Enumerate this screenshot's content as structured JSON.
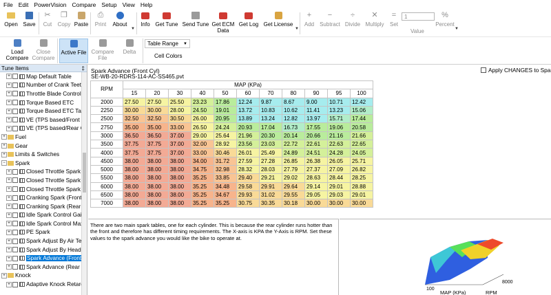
{
  "menu": [
    "File",
    "Edit",
    "PowerVision",
    "Compare",
    "Setup",
    "View",
    "Help"
  ],
  "toolbar1": {
    "open": "Open",
    "save": "Save",
    "cut": "Cut",
    "copy": "Copy",
    "paste": "Paste",
    "print": "Print",
    "about": "About",
    "info": "Info",
    "get_tune": "Get Tune",
    "send_tune": "Send Tune",
    "get_ecm_line1": "Get ECM",
    "get_ecm_line2": "Data",
    "get_log": "Get Log",
    "get_license": "Get License",
    "add": "Add",
    "subtract": "Subtract",
    "divide": "Divide",
    "multiply": "Multiply",
    "set": "Set",
    "value_field": "1",
    "value_label": "Value",
    "percent": "Percent"
  },
  "toolbar2": {
    "load_compare_line1": "Load",
    "load_compare_line2": "Compare",
    "close_compare_line1": "Close",
    "close_compare_line2": "Compare",
    "active_file": "Active File",
    "compare_file": "Compare File",
    "delta": "Delta",
    "table_range": "Table Range",
    "cell_colors": "Cell Colors"
  },
  "left_panel": {
    "header": "Tune Items",
    "pin": "‡",
    "items": [
      {
        "label": "Map Default Table",
        "kind": "table",
        "level": 1
      },
      {
        "label": "Number of Crank Teeth",
        "kind": "table",
        "level": 1
      },
      {
        "label": "Throttle Blade Control",
        "kind": "table",
        "level": 1
      },
      {
        "label": "Torque Based ETC",
        "kind": "table",
        "level": 1
      },
      {
        "label": "Torque Based ETC Table",
        "kind": "table",
        "level": 1
      },
      {
        "label": "VE (TPS based/Front Cyl)",
        "kind": "table",
        "level": 1
      },
      {
        "label": "VE (TPS based/Rear Cyl)",
        "kind": "table",
        "level": 1
      },
      {
        "label": "Fuel",
        "kind": "folder",
        "level": 0
      },
      {
        "label": "Gear",
        "kind": "folder",
        "level": 0
      },
      {
        "label": "Limits & Switches",
        "kind": "folder",
        "level": 0
      },
      {
        "label": "Spark",
        "kind": "folder",
        "level": 0
      },
      {
        "label": "Closed Throttle Spark (Front Cyl)",
        "kind": "table",
        "level": 1
      },
      {
        "label": "Closed Throttle Spark (Rear Cyl)",
        "kind": "table",
        "level": 1
      },
      {
        "label": "Closed Throttle Spark Multiplier",
        "kind": "table",
        "level": 1
      },
      {
        "label": "Cranking Spark (Front Cyl)",
        "kind": "table",
        "level": 1
      },
      {
        "label": "Cranking Spark (Rear Cyl)",
        "kind": "table",
        "level": 1
      },
      {
        "label": "Idle Spark Control Gain",
        "kind": "table",
        "level": 1
      },
      {
        "label": "Idle Spark Control Max",
        "kind": "table",
        "level": 1
      },
      {
        "label": "PE Spark",
        "kind": "table",
        "level": 1
      },
      {
        "label": "Spark Adjust By Air Temp",
        "kind": "table",
        "level": 1
      },
      {
        "label": "Spark Adjust By Head Temp",
        "kind": "table",
        "level": 1
      },
      {
        "label": "Spark Advance (Front Cyl)",
        "kind": "table",
        "level": 1,
        "selected": true
      },
      {
        "label": "Spark Advance (Rear Cyl)",
        "kind": "table",
        "level": 1
      },
      {
        "label": "Knock",
        "kind": "folder",
        "level": 0
      },
      {
        "label": "Adaptive Knock Retard",
        "kind": "table",
        "level": 1
      }
    ]
  },
  "table_view": {
    "title": "Spark Advance (Front Cyl)",
    "file": "SE-WB-20-RDRS-114-AC-SS465.pvt",
    "apply_label": "Apply CHANGES to Spark Ac",
    "row_axis_label": "RPM",
    "col_axis_label": "MAP (KPa)",
    "columns": [
      "15",
      "20",
      "30",
      "40",
      "50",
      "60",
      "70",
      "80",
      "90",
      "95",
      "100"
    ],
    "rows": [
      {
        "rpm": "2000",
        "v": [
          "27.50",
          "27.50",
          "25.50",
          "23.23",
          "17.86",
          "12.24",
          "9.87",
          "8.67",
          "9.00",
          "10.71",
          "12.42"
        ]
      },
      {
        "rpm": "2250",
        "v": [
          "30.00",
          "30.00",
          "28.00",
          "24.50",
          "19.01",
          "13.72",
          "10.83",
          "10.62",
          "11.41",
          "13.23",
          "15.06"
        ]
      },
      {
        "rpm": "2500",
        "v": [
          "32.50",
          "32.50",
          "30.50",
          "26.00",
          "20.95",
          "13.89",
          "13.24",
          "12.82",
          "13.97",
          "15.71",
          "17.44"
        ]
      },
      {
        "rpm": "2750",
        "v": [
          "35.00",
          "35.00",
          "33.00",
          "26.50",
          "24.24",
          "20.93",
          "17.04",
          "16.73",
          "17.55",
          "19.06",
          "20.58"
        ]
      },
      {
        "rpm": "3000",
        "v": [
          "36.50",
          "36.50",
          "37.00",
          "29.00",
          "25.64",
          "21.96",
          "20.30",
          "20.14",
          "20.66",
          "21.16",
          "21.66"
        ]
      },
      {
        "rpm": "3500",
        "v": [
          "37.75",
          "37.75",
          "37.00",
          "32.00",
          "28.92",
          "23.56",
          "23.03",
          "22.72",
          "22.61",
          "22.63",
          "22.65"
        ]
      },
      {
        "rpm": "4000",
        "v": [
          "37.75",
          "37.75",
          "37.00",
          "33.00",
          "30.46",
          "26.01",
          "25.49",
          "24.89",
          "24.51",
          "24.28",
          "24.05"
        ]
      },
      {
        "rpm": "4500",
        "v": [
          "38.00",
          "38.00",
          "38.00",
          "34.00",
          "31.72",
          "27.59",
          "27.28",
          "26.85",
          "26.38",
          "26.05",
          "25.71"
        ]
      },
      {
        "rpm": "5000",
        "v": [
          "38.00",
          "38.00",
          "38.00",
          "34.75",
          "32.98",
          "28.32",
          "28.03",
          "27.79",
          "27.37",
          "27.09",
          "26.82"
        ]
      },
      {
        "rpm": "5500",
        "v": [
          "38.00",
          "38.00",
          "38.00",
          "35.25",
          "33.85",
          "29.40",
          "29.21",
          "29.02",
          "28.63",
          "28.44",
          "28.25"
        ]
      },
      {
        "rpm": "6000",
        "v": [
          "38.00",
          "38.00",
          "38.00",
          "35.25",
          "34.48",
          "29.58",
          "29.91",
          "29.64",
          "29.14",
          "29.01",
          "28.88"
        ]
      },
      {
        "rpm": "6500",
        "v": [
          "38.00",
          "38.00",
          "38.00",
          "35.25",
          "34.67",
          "29.93",
          "31.02",
          "29.55",
          "29.05",
          "29.03",
          "29.01"
        ]
      },
      {
        "rpm": "7000",
        "v": [
          "38.00",
          "38.00",
          "38.00",
          "35.25",
          "35.25",
          "30.75",
          "30.35",
          "30.18",
          "30.00",
          "30.00",
          "30.00"
        ]
      }
    ]
  },
  "description": "There are two main spark tables, one for each cylinder.  This is because the rear cylinder runs hotter than the front and therefore has different timing requirements.  The X-axis is KPA the Y-Axis is RPM.  Set these values to the spark advance you would like the bike to operate at.",
  "plot_labels": {
    "z_axis": "100",
    "x_axis": "MAP (KPa)",
    "rpm_axis": "RPM",
    "rpm_value": "8000"
  },
  "colors": {
    "selection": "#0078d7",
    "active_button": "#cde3f7",
    "panel_header": "#dbe7f4"
  }
}
